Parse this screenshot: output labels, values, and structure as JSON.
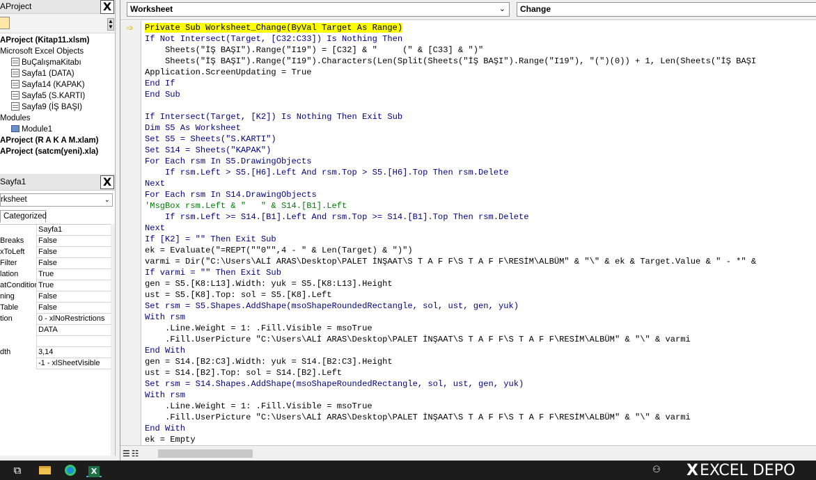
{
  "project_pane": {
    "title": "AProject",
    "close": "X",
    "tree": [
      {
        "label": "AProject (Kitap11.xlsm)",
        "bold": true
      },
      {
        "label": "Microsoft Excel Objects"
      },
      {
        "label": "BuÇalışmaKitabı",
        "icon": "sheet"
      },
      {
        "label": "Sayfa1 (DATA)",
        "icon": "sheet"
      },
      {
        "label": "Sayfa14 (KAPAK)",
        "icon": "sheet"
      },
      {
        "label": "Sayfa5 (S.KARTI)",
        "icon": "sheet"
      },
      {
        "label": "Sayfa9 (İŞ BAŞI)",
        "icon": "sheet"
      },
      {
        "label": "Modules"
      },
      {
        "label": "Module1",
        "icon": "module"
      },
      {
        "label": "AProject (R A K A M.xlam)",
        "bold": true
      },
      {
        "label": "AProject (satcm(yeni).xla)",
        "bold": true
      }
    ]
  },
  "properties_pane": {
    "title": "Sayfa1",
    "close": "X",
    "object_select": "rksheet",
    "tab_label": "Categorized",
    "rows": [
      {
        "name": "",
        "value": "Sayfa1"
      },
      {
        "name": "Breaks",
        "value": "False"
      },
      {
        "name": "xToLeft",
        "value": "False"
      },
      {
        "name": "Filter",
        "value": "False"
      },
      {
        "name": "lation",
        "value": "True"
      },
      {
        "name": "atCondition",
        "value": "True"
      },
      {
        "name": "ning",
        "value": "False"
      },
      {
        "name": "Table",
        "value": "False"
      },
      {
        "name": "tion",
        "value": "0 - xlNoRestrictions"
      },
      {
        "name": "",
        "value": "DATA"
      },
      {
        "name": "",
        "value": ""
      },
      {
        "name": "dth",
        "value": "3,14"
      },
      {
        "name": "",
        "value": "-1 - xlSheetVisible"
      }
    ]
  },
  "code_window": {
    "object_combo": "Worksheet",
    "procedure_combo": "Change",
    "lines": [
      {
        "t": "Private Sub Worksheet_Change(ByVal Target As Range)",
        "k": "hl"
      },
      {
        "t": "If Not Intersect(Target, [C32:C33]) Is Nothing Then",
        "k": "kw"
      },
      {
        "t": "    Sheets(\"İŞ BAŞI\").Range(\"I19\") = [C32] & \"     (\" & [C33] & \")\""
      },
      {
        "t": "    Sheets(\"İŞ BAŞI\").Range(\"I19\").Characters(Len(Split(Sheets(\"İŞ BAŞI\").Range(\"I19\"), \"(\")(0)) + 1, Len(Sheets(\"İŞ BAŞI"
      },
      {
        "t": "Application.ScreenUpdating = True"
      },
      {
        "t": "End If",
        "k": "kw"
      },
      {
        "t": "End Sub",
        "k": "kw"
      },
      {
        "t": ""
      },
      {
        "t": "If Intersect(Target, [K2]) Is Nothing Then Exit Sub",
        "k": "kw"
      },
      {
        "t": "Dim S5 As Worksheet",
        "k": "kw"
      },
      {
        "t": "Set S5 = Sheets(\"S.KARTI\")",
        "k": "kw"
      },
      {
        "t": "Set S14 = Sheets(\"KAPAK\")",
        "k": "kw"
      },
      {
        "t": "For Each rsm In S5.DrawingObjects",
        "k": "kw"
      },
      {
        "t": "    If rsm.Left > S5.[H6].Left And rsm.Top > S5.[H6].Top Then rsm.Delete",
        "k": "kw"
      },
      {
        "t": "Next",
        "k": "kw"
      },
      {
        "t": "For Each rsm In S14.DrawingObjects",
        "k": "kw"
      },
      {
        "t": "'MsgBox rsm.Left & \"   \" & S14.[B1].Left",
        "k": "cm"
      },
      {
        "t": "    If rsm.Left >= S14.[B1].Left And rsm.Top >= S14.[B1].Top Then rsm.Delete",
        "k": "kw"
      },
      {
        "t": "Next",
        "k": "kw"
      },
      {
        "t": "If [K2] = \"\" Then Exit Sub",
        "k": "kw"
      },
      {
        "t": "ek = Evaluate(\"=REPT(\"\"0\"\",4 - \" & Len(Target) & \")\")"
      },
      {
        "t": "varmi = Dir(\"C:\\Users\\ALİ ARAS\\Desktop\\PALET İNŞAAT\\S T A F F\\S T A F F\\RESİM\\ALBÜM\" & \"\\\" & ek & Target.Value & \" - *\" &"
      },
      {
        "t": "If varmi = \"\" Then Exit Sub",
        "k": "kw"
      },
      {
        "t": "gen = S5.[K8:L13].Width: yuk = S5.[K8:L13].Height"
      },
      {
        "t": "ust = S5.[K8].Top: sol = S5.[K8].Left"
      },
      {
        "t": "Set rsm = S5.Shapes.AddShape(msoShapeRoundedRectangle, sol, ust, gen, yuk)",
        "k": "kw"
      },
      {
        "t": "With rsm",
        "k": "kw"
      },
      {
        "t": "    .Line.Weight = 1: .Fill.Visible = msoTrue"
      },
      {
        "t": "    .Fill.UserPicture \"C:\\Users\\ALİ ARAS\\Desktop\\PALET İNŞAAT\\S T A F F\\S T A F F\\RESİM\\ALBÜM\" & \"\\\" & varmi"
      },
      {
        "t": "End With",
        "k": "kw"
      },
      {
        "t": "gen = S14.[B2:C3].Width: yuk = S14.[B2:C3].Height"
      },
      {
        "t": "ust = S14.[B2].Top: sol = S14.[B2].Left"
      },
      {
        "t": "Set rsm = S14.Shapes.AddShape(msoShapeRoundedRectangle, sol, ust, gen, yuk)",
        "k": "kw"
      },
      {
        "t": "With rsm",
        "k": "kw"
      },
      {
        "t": "    .Line.Weight = 1: .Fill.Visible = msoTrue"
      },
      {
        "t": "    .Fill.UserPicture \"C:\\Users\\ALİ ARAS\\Desktop\\PALET İNŞAAT\\S T A F F\\S T A F F\\RESİM\\ALBÜM\" & \"\\\" & varmi"
      },
      {
        "t": "End With",
        "k": "kw"
      },
      {
        "t": "ek = Empty"
      }
    ]
  },
  "taskbar": {
    "watermark": "EXCEL DEPO",
    "watermark_x": "X",
    "icons": [
      "task-view-icon",
      "file-explorer-icon",
      "edge-icon",
      "excel-icon",
      "people-icon"
    ]
  },
  "colors": {
    "keyword": "#00008b",
    "comment": "#008000",
    "highlight": "#ffff00",
    "exec_arrow": "#e0b000",
    "taskbar": "#1c1c1c"
  }
}
